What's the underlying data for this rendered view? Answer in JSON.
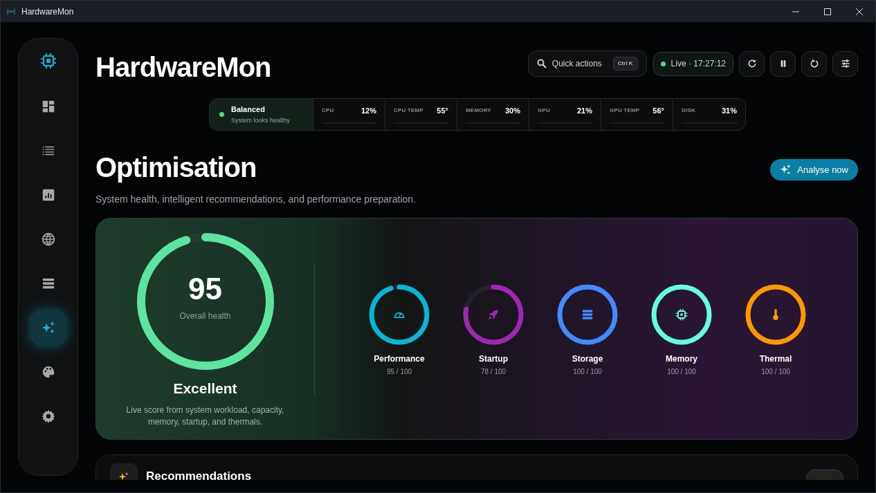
{
  "window": {
    "title": "HardwareMon"
  },
  "sidebar": {
    "items": [
      {
        "kind": "dashboard",
        "selected": false
      },
      {
        "kind": "list",
        "selected": false
      },
      {
        "kind": "chart",
        "selected": false
      },
      {
        "kind": "globe",
        "selected": false
      },
      {
        "kind": "storage",
        "selected": false
      },
      {
        "kind": "sparkle",
        "selected": true
      },
      {
        "kind": "palette",
        "selected": false
      },
      {
        "kind": "gear",
        "selected": false
      }
    ]
  },
  "header": {
    "title": "HardwareMon",
    "quick_actions": {
      "label": "Quick actions",
      "shortcut": "Ctrl K"
    },
    "live": "Live · 17:27:12",
    "buttons": [
      {
        "kind": "refresh"
      },
      {
        "kind": "pause"
      },
      {
        "kind": "reset"
      },
      {
        "kind": "tune"
      }
    ]
  },
  "status_strip": {
    "mode": "Balanced",
    "note": "System looks healthy",
    "metrics": [
      {
        "label": "CPU",
        "value": "12%"
      },
      {
        "label": "CPU TEMP",
        "value": "55°"
      },
      {
        "label": "MEMORY",
        "value": "30%"
      },
      {
        "label": "GPU",
        "value": "21%"
      },
      {
        "label": "GPU TEMP",
        "value": "56°"
      },
      {
        "label": "DISK",
        "value": "31%"
      }
    ]
  },
  "page": {
    "title": "Optimisation",
    "subtitle": "System health, intelligent recommendations, and performance preparation.",
    "action": "Analyse now"
  },
  "health": {
    "score": "95",
    "score_label": "Overall health",
    "level": 0.95,
    "rating": "Excellent",
    "description": "Live score from system workload, capacity, memory, startup, and thermals.",
    "categories": [
      {
        "kind": "gauge",
        "name": "Performance",
        "score": "95 / 100",
        "level": 0.95,
        "color": "#06b6d4"
      },
      {
        "kind": "rocket",
        "name": "Startup",
        "score": "78 / 100",
        "level": 0.78,
        "color": "#9c27b0"
      },
      {
        "kind": "storage",
        "name": "Storage",
        "score": "100 / 100",
        "level": 1,
        "color": "#448aff"
      },
      {
        "kind": "chip",
        "name": "Memory",
        "score": "100 / 100",
        "level": 1,
        "color": "#64ffda"
      },
      {
        "kind": "thermo",
        "name": "Thermal",
        "score": "100 / 100",
        "level": 1,
        "color": "#ff9800"
      }
    ]
  },
  "recommendations": {
    "title": "Recommendations"
  }
}
